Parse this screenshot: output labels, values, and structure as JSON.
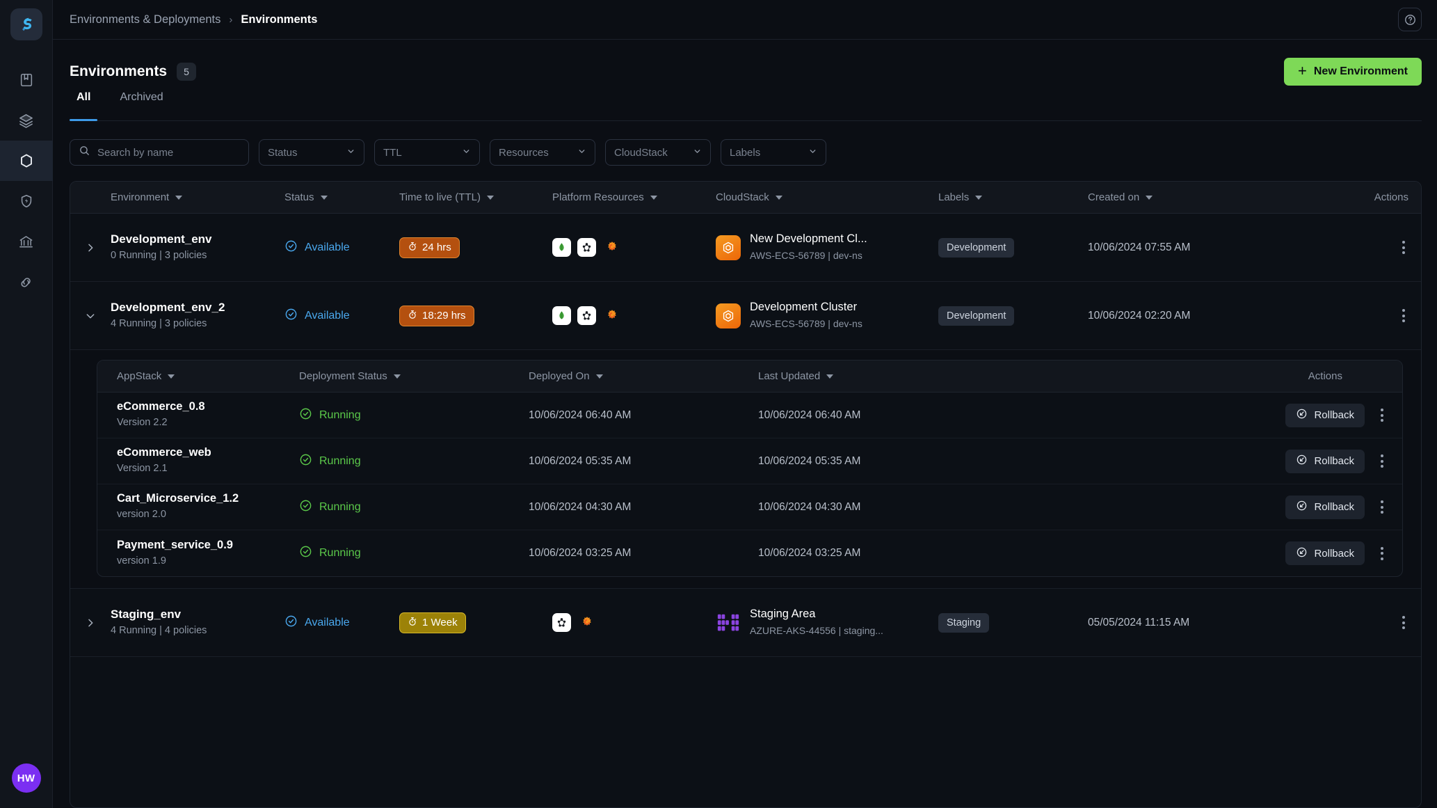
{
  "sidebar": {
    "logo_icon": "app-logo-icon",
    "items": [
      {
        "icon": "book-icon",
        "name": "book",
        "active": false
      },
      {
        "icon": "layers-icon",
        "name": "layers",
        "active": false
      },
      {
        "icon": "hexagon-icon",
        "name": "environments",
        "active": true
      },
      {
        "icon": "shield-bolt-icon",
        "name": "security",
        "active": false
      },
      {
        "icon": "bank-icon",
        "name": "governance",
        "active": false
      },
      {
        "icon": "link-icon",
        "name": "integrations",
        "active": false
      }
    ],
    "avatar_initials": "HW"
  },
  "topbar": {
    "breadcrumb_parent": "Environments & Deployments",
    "breadcrumb_separator": "›",
    "breadcrumb_current": "Environments",
    "help_icon": "help-circle-icon"
  },
  "header": {
    "title": "Environments",
    "count": "5",
    "new_button_label": "New Environment",
    "new_button_plus": "+",
    "new_button_color": "#7ed957"
  },
  "tabs": [
    {
      "label": "All",
      "active": true
    },
    {
      "label": "Archived",
      "active": false
    }
  ],
  "filters": {
    "search_placeholder": "Search by name",
    "search_value": "",
    "search_icon": "search-icon",
    "selects": [
      {
        "label": "Status",
        "name": "status"
      },
      {
        "label": "TTL",
        "name": "ttl"
      },
      {
        "label": "Resources",
        "name": "resources"
      },
      {
        "label": "CloudStack",
        "name": "cloudstack"
      },
      {
        "label": "Labels",
        "name": "labels"
      }
    ]
  },
  "table": {
    "columns": [
      {
        "label": "Environment",
        "sortable": true
      },
      {
        "label": "Status",
        "sortable": true
      },
      {
        "label": "Time to live (TTL)",
        "sortable": true
      },
      {
        "label": "Platform Resources",
        "sortable": true
      },
      {
        "label": "CloudStack",
        "sortable": true
      },
      {
        "label": "Labels",
        "sortable": true
      },
      {
        "label": "Created on",
        "sortable": true
      },
      {
        "label": "Actions",
        "sortable": false
      }
    ],
    "rows": [
      {
        "name": "Development_env",
        "sub": "0 Running | 3 policies",
        "expanded": false,
        "status": "Available",
        "status_color": "#4aa8ee",
        "ttl": "24 hrs",
        "ttl_style": "orange",
        "resources": [
          "mongodb-icon",
          "kubeflow-icon",
          "grafana-icon"
        ],
        "cloud_logo": "aws-icon",
        "cloud_name": "New Development Cl...",
        "cloud_sub": "AWS-ECS-56789 | dev-ns",
        "label": "Development",
        "created": "10/06/2024 07:55 AM"
      },
      {
        "name": "Development_env_2",
        "sub": "4 Running | 3 policies",
        "expanded": true,
        "status": "Available",
        "status_color": "#4aa8ee",
        "ttl": "18:29 hrs",
        "ttl_style": "orange",
        "resources": [
          "mongodb-icon",
          "kubeflow-icon",
          "grafana-icon"
        ],
        "cloud_logo": "aws-icon",
        "cloud_name": "Development Cluster",
        "cloud_sub": "AWS-ECS-56789 | dev-ns",
        "label": "Development",
        "created": "10/06/2024 02:20 AM"
      },
      {
        "name": "Staging_env",
        "sub": "4 Running | 4 policies",
        "expanded": false,
        "status": "Available",
        "status_color": "#4aa8ee",
        "ttl": "1 Week",
        "ttl_style": "yellow",
        "resources": [
          "kubeflow-icon",
          "grafana-icon"
        ],
        "cloud_logo": "azure-icon",
        "cloud_name": "Staging Area",
        "cloud_sub": "AZURE-AKS-44556 | staging...",
        "label": "Staging",
        "created": "05/05/2024 11:15 AM"
      }
    ]
  },
  "nested_table": {
    "columns": [
      {
        "label": "AppStack",
        "sortable": true
      },
      {
        "label": "Deployment Status",
        "sortable": true
      },
      {
        "label": "Deployed On",
        "sortable": true
      },
      {
        "label": "Last Updated",
        "sortable": true
      },
      {
        "label": "Actions",
        "sortable": false
      }
    ],
    "rollback_label": "Rollback",
    "rows": [
      {
        "app": "eCommerce_0.8",
        "version": "Version 2.2",
        "status": "Running",
        "deployed_on": "10/06/2024 06:40 AM",
        "last_updated": "10/06/2024 06:40 AM"
      },
      {
        "app": "eCommerce_web",
        "version": "Version 2.1",
        "status": "Running",
        "deployed_on": "10/06/2024 05:35 AM",
        "last_updated": "10/06/2024 05:35 AM"
      },
      {
        "app": "Cart_Microservice_1.2",
        "version": "version 2.0",
        "status": "Running",
        "deployed_on": "10/06/2024 04:30 AM",
        "last_updated": "10/06/2024 04:30 AM"
      },
      {
        "app": "Payment_service_0.9",
        "version": "version 1.9",
        "status": "Running",
        "deployed_on": "10/06/2024 03:25 AM",
        "last_updated": "10/06/2024 03:25 AM"
      }
    ]
  }
}
